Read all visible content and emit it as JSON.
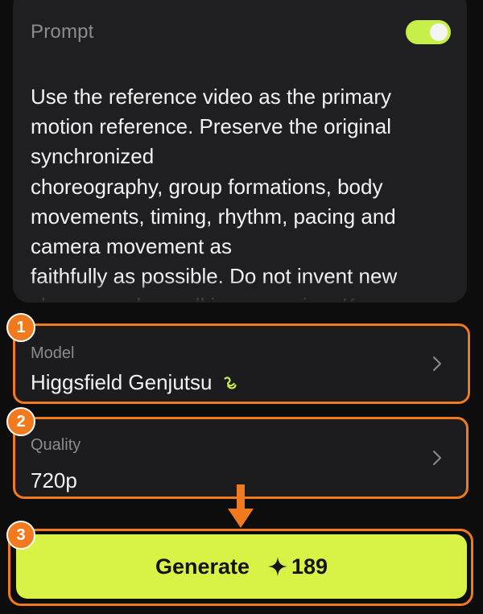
{
  "prompt": {
    "label": "Prompt",
    "enabled": true,
    "text": "Use the reference video as the primary\nmotion reference. Preserve the original\nsynchronized\nchoreography, group formations, body\nmovements, timing, rhythm, pacing and\ncamera movement as\nfaithfully as possible. Do not invent new\nchoreography, walking or posing. Keep"
  },
  "settings": {
    "model": {
      "label": "Model",
      "value": "Higgsfield Genjutsu"
    },
    "quality": {
      "label": "Quality",
      "value": "720p"
    }
  },
  "generate": {
    "label": "Generate",
    "cost": "189"
  },
  "steps": [
    "1",
    "2",
    "3"
  ],
  "colors": {
    "accent": "#d9f246",
    "highlight": "#f07a1d",
    "panel": "#1f1f21",
    "background": "#0d0d0e"
  }
}
